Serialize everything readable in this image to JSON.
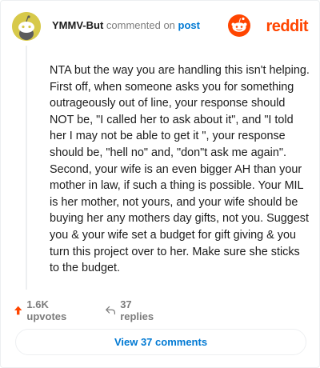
{
  "header": {
    "author": "YMMV-But",
    "commented": "commented on",
    "post_link": "post",
    "logo_text": "reddit"
  },
  "comment": {
    "body": "NTA but the way you are handling this isn't helping. First off, when someone asks you for something outrageously out of line, your response should NOT be, \"I called her to ask about it\", and \"I told her I may not be able to get it \", your response should be, \"hell no\" and, \"don\"t ask me again\". Second, your wife is an even bigger AH than your mother in law, if such a thing is possible. Your MIL is her mother, not yours, and your wife should be buying her any mothers day gifts, not you. Suggest you & your wife set a budget for gift giving & you turn this project over to her. Make sure she sticks to the budget."
  },
  "actions": {
    "upvotes": "1.6K upvotes",
    "replies": "37 replies",
    "view_comments": "View 37 comments"
  },
  "colors": {
    "accent": "#ff4500",
    "link": "#0079d3",
    "muted": "#7c7c7c",
    "avatar": "#d7c94a"
  },
  "icons": {
    "upvote": "upvote-arrow-icon",
    "reply": "reply-arrow-icon",
    "logo": "reddit-snoo-icon"
  }
}
